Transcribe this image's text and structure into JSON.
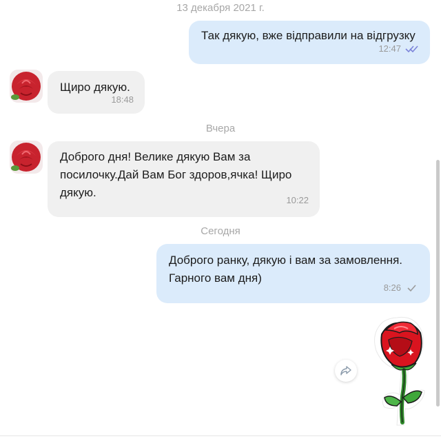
{
  "separators": {
    "date_1": "13 декабря 2021 г.",
    "yesterday": "Вчера",
    "today": "Сегодня"
  },
  "messages": [
    {
      "direction": "outgoing",
      "text": "Так дякую, вже відправили на відгрузку",
      "time": "12:47",
      "status": "read"
    },
    {
      "direction": "incoming",
      "text": "Щиро дякую.",
      "time": "18:48"
    },
    {
      "direction": "incoming",
      "text": "Доброго дня! Велике дякую Вам за\nпосилочку.Дай Вам Бог здоров,ячка! Щиро\nдякую.",
      "time": "10:22"
    },
    {
      "direction": "outgoing",
      "text": "Доброго ранку, дякую і вам за замовлення.\nГарного вам дня)",
      "time": "8:26",
      "status": "sent"
    },
    {
      "direction": "outgoing",
      "type": "sticker",
      "sticker": "red-rose-sticker"
    }
  ],
  "colors": {
    "outgoing_bubble": "#dbebfb",
    "incoming_bubble": "#f0f0f0",
    "read_check": "#7b83d9",
    "meta_text": "#9a9a9a"
  },
  "icons": {
    "read": "double-check-icon",
    "sent": "single-check-icon",
    "share": "share-arrow-icon",
    "avatar": "rose-avatar"
  }
}
